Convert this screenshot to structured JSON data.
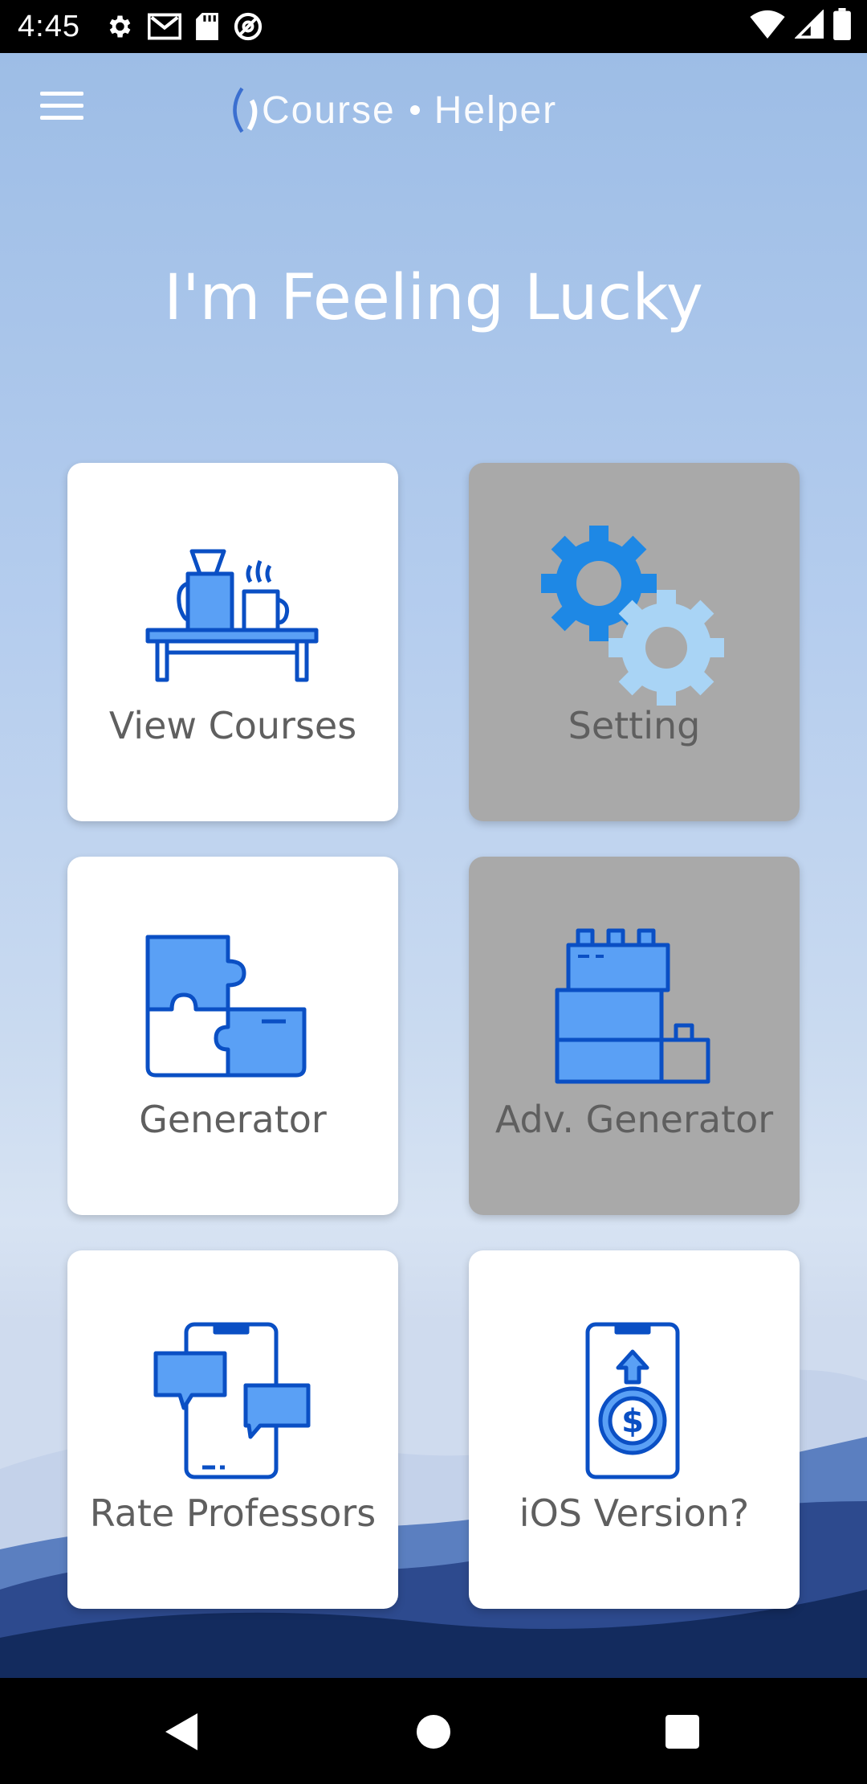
{
  "status_bar": {
    "time": "4:45",
    "left_icons": [
      "gear-icon",
      "gmail-icon",
      "sd-card-icon",
      "at-sign-icon"
    ],
    "right_icons": [
      "wifi-icon",
      "cell-signal-icon",
      "battery-icon"
    ]
  },
  "header": {
    "menu_icon": "hamburger-menu-icon",
    "logo_word_1": "Course",
    "logo_word_2": "Helper"
  },
  "page": {
    "title": "I'm Feeling Lucky"
  },
  "tiles": [
    {
      "label": "View Courses",
      "icon": "coffee-table-icon",
      "style": "white"
    },
    {
      "label": "Setting",
      "icon": "gears-icon",
      "style": "gray"
    },
    {
      "label": "Generator",
      "icon": "puzzle-icon",
      "style": "white"
    },
    {
      "label": "Adv. Generator",
      "icon": "building-blocks-icon",
      "style": "gray"
    },
    {
      "label": "Rate Professors",
      "icon": "phone-chat-icon",
      "style": "white"
    },
    {
      "label": "iOS Version?",
      "icon": "phone-dollar-icon",
      "style": "white"
    }
  ],
  "colors": {
    "icon_blue_dark": "#0a4fc4",
    "icon_blue_fill": "#5aa0f5",
    "gear_blue": "#1e88e5",
    "gear_light": "#a9d4f5",
    "tile_gray": "#a9a9a9",
    "label_gray": "#5f5f5f"
  },
  "nav_bar": {
    "buttons": [
      "back-icon",
      "home-icon",
      "recents-icon"
    ]
  }
}
